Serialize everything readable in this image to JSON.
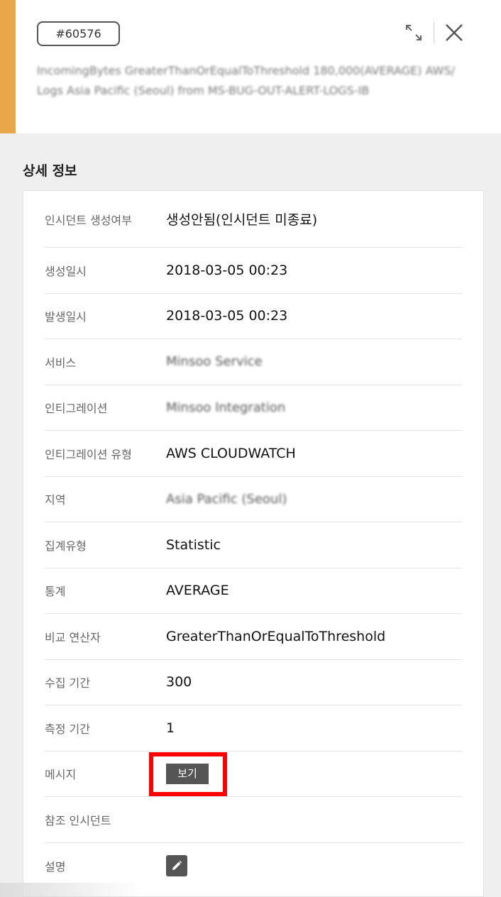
{
  "header": {
    "incident_id": "#60576",
    "summary": "IncomingBytes GreaterThanOrEqualToThreshold 180,000(AVERAGE) AWS/Logs Asia Pacific (Seoul) from MS-BUG-OUT-ALERT-LOGS-IB",
    "expand_icon": "expand-icon",
    "close_icon": "close-icon",
    "accent_color": "#e8a84a"
  },
  "section": {
    "title": "상세 정보"
  },
  "details": {
    "rows": [
      {
        "label": "인시던트 생성여부",
        "value": "생성안됨(인시던트 미종료)"
      },
      {
        "label": "생성일시",
        "value": "2018-03-05 00:23"
      },
      {
        "label": "발생일시",
        "value": "2018-03-05 00:23"
      },
      {
        "label": "서비스",
        "value": "Minsoo Service"
      },
      {
        "label": "인티그레이션",
        "value": "Minsoo Integration"
      },
      {
        "label": "인티그레이션 유형",
        "value": "AWS CLOUDWATCH"
      },
      {
        "label": "지역",
        "value": "Asia Pacific (Seoul)"
      },
      {
        "label": "집계유형",
        "value": "Statistic"
      },
      {
        "label": "통계",
        "value": "AVERAGE"
      },
      {
        "label": "비교 연산자",
        "value": "GreaterThanOrEqualToThreshold"
      },
      {
        "label": "수집 기간",
        "value": "300"
      },
      {
        "label": "측정 기간",
        "value": "1"
      },
      {
        "label": "메시지",
        "button": "보기"
      },
      {
        "label": "참조 인시던트",
        "value": ""
      },
      {
        "label": "설명",
        "edit_icon": "pencil-icon"
      }
    ]
  }
}
